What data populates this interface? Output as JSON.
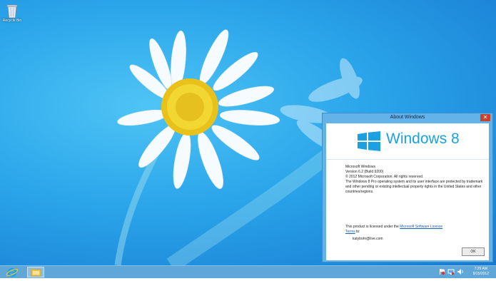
{
  "desktop": {
    "recycle_bin_label": "Recycle Bin"
  },
  "dialog": {
    "title": "About Windows",
    "close_glyph": "✕",
    "logo_text": "Windows 8",
    "product_name": "Microsoft Windows",
    "version": "Version 6.2 (Build 9200)",
    "copyright": "© 2012 Microsoft Corporation. All rights reserved.",
    "protection_text": "The Windows 8 Pro operating system and its user interface are protected by trademark and other pending or existing intellectual property rights in the United States and other countries/regions.",
    "license_prefix": "This product is licensed under the",
    "license_link_1": "Microsoft Software License",
    "license_link_2": "Terms",
    "license_suffix": "to:",
    "licensee": "katybohr@live.com",
    "ok_label": "OK"
  },
  "taskbar": {
    "pinned": [
      {
        "icon": "internet-explorer-icon"
      },
      {
        "icon": "file-explorer-icon"
      }
    ],
    "tray_icons": [
      "action-center-flag-icon",
      "network-icon",
      "volume-icon"
    ],
    "time": "7:29 AM",
    "date": "8/15/2012"
  },
  "colors": {
    "accent": "#1ba1e2",
    "taskbar": "#5fa7d8",
    "dialog_frame": "#63b2e8",
    "close_button": "#c7412f"
  }
}
